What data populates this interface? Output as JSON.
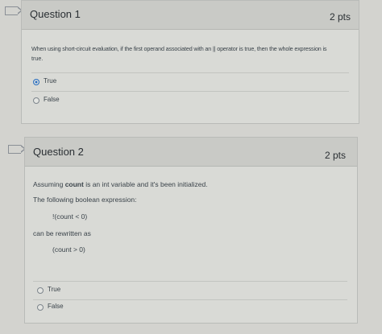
{
  "question1": {
    "title": "Question 1",
    "points": "2 pts",
    "prompt_line1": "When using short-circuit evaluation, if the first operand associated with an || operator is true, then the whole expression is",
    "prompt_line2": "true.",
    "options": [
      {
        "label": "True",
        "selected": true
      },
      {
        "label": "False",
        "selected": false
      }
    ]
  },
  "question2": {
    "title": "Question 2",
    "points": "2 pts",
    "line1_pre": "Assuming ",
    "line1_bold": "count",
    "line1_post": " is an int variable and it's been initialized.",
    "line2": "The following boolean expression:",
    "expr1": "!(count < 0)",
    "line3": "can be rewritten as",
    "expr2": "(count > 0)",
    "options": [
      {
        "label": "True",
        "selected": false
      },
      {
        "label": "False",
        "selected": false
      }
    ]
  },
  "colors": {
    "selected_radio": "#2c6fbf",
    "background": "#d3d3cf"
  }
}
